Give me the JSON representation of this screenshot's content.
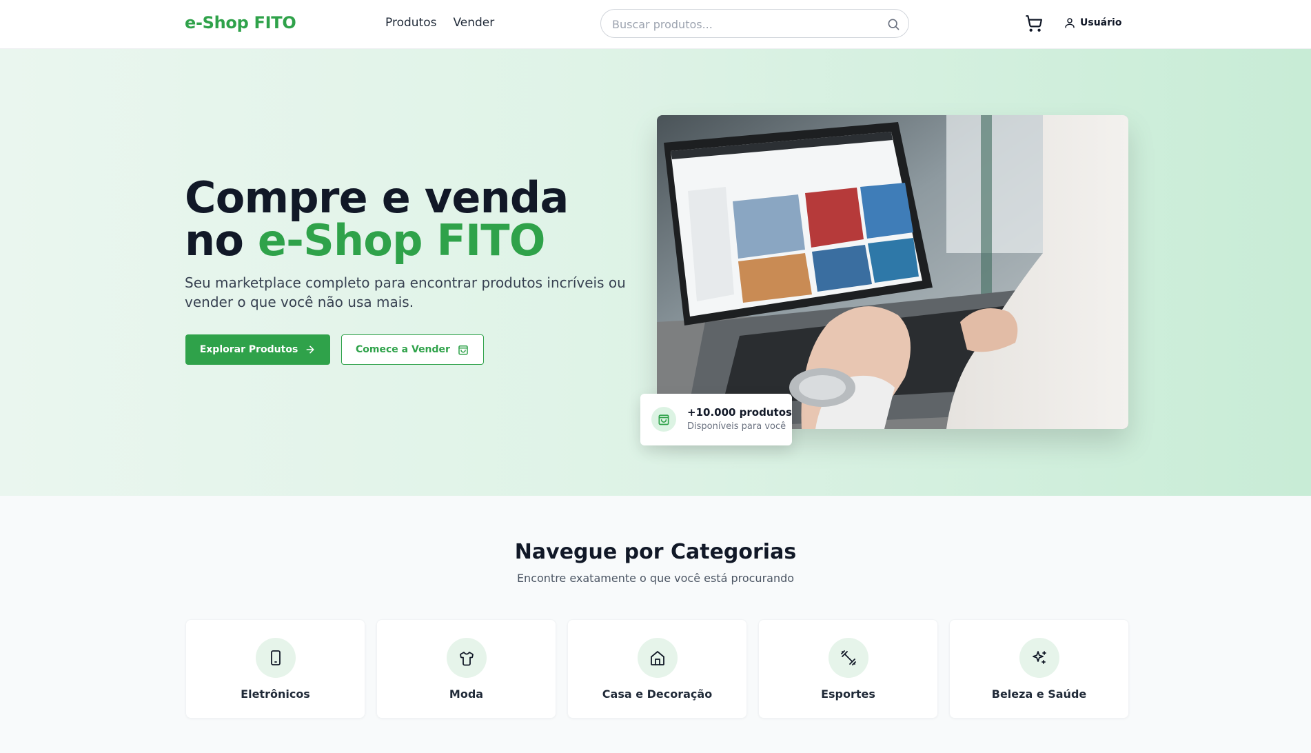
{
  "header": {
    "logo": "e-Shop FITO",
    "nav": [
      {
        "label": "Produtos"
      },
      {
        "label": "Vender"
      }
    ],
    "search": {
      "placeholder": "Buscar produtos...",
      "value": ""
    },
    "user_label": "Usuário"
  },
  "hero": {
    "title_part1": "Compre e venda no ",
    "title_accent": "e-Shop FITO",
    "subtitle": "Seu marketplace completo para encontrar produtos incríveis ou vender o que você não usa mais.",
    "primary_button": "Explorar Produtos",
    "secondary_button": "Comece a Vender",
    "stat": {
      "title": "+10.000 produtos",
      "description": "Disponíveis para você"
    }
  },
  "categories": {
    "title": "Navegue por Categorias",
    "subtitle": "Encontre exatamente o que você está procurando",
    "items": [
      {
        "label": "Eletrônicos",
        "icon": "smartphone-icon"
      },
      {
        "label": "Moda",
        "icon": "shirt-icon"
      },
      {
        "label": "Casa e Decoração",
        "icon": "home-icon"
      },
      {
        "label": "Esportes",
        "icon": "dumbbell-icon"
      },
      {
        "label": "Beleza e Saúde",
        "icon": "sparkles-icon"
      }
    ]
  },
  "colors": {
    "brand": "#2fa24a",
    "text": "#111827",
    "hero_bg_start": "#eaf6ef",
    "hero_bg_end": "#c8ecd6"
  }
}
